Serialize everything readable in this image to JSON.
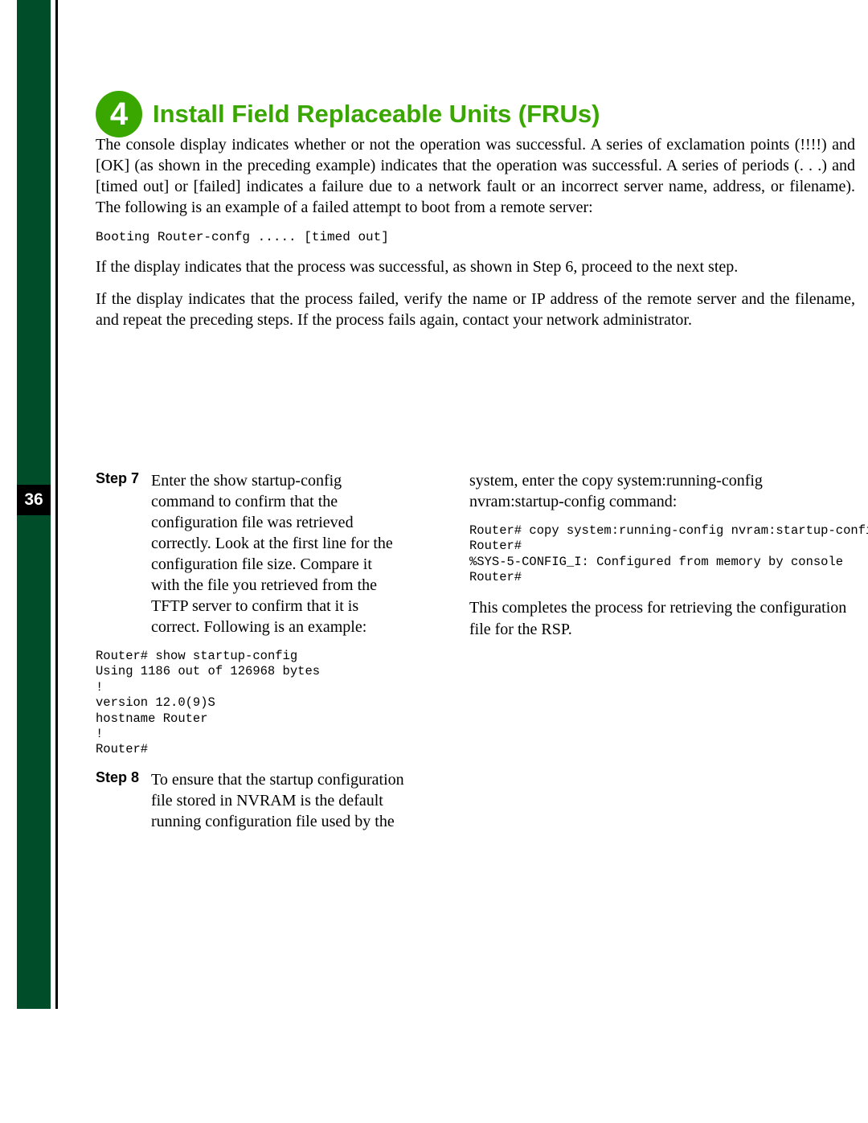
{
  "chapter": {
    "number": "4",
    "title": "Install Field Replaceable Units (FRUs)"
  },
  "page_number": "36",
  "intro": {
    "p1": "The console display indicates whether or not the operation was successful. A series of exclamation points (!!!!) and [OK] (as shown in the preceding example) indicates that the operation was successful. A series of periods (. . .) and [timed out] or [failed] indicates a failure due to a network fault or an incorrect server name, address, or filename). The following is an example of a failed attempt to boot from a remote server:",
    "code1": "Booting Router-confg ..... [timed out]",
    "p2": "If the display indicates that the process was successful, as shown in Step 6, proceed to the next step.",
    "p3": "If the display indicates that the process failed, verify the name or IP address of the remote server and the filename, and repeat the preceding steps. If the process fails again, contact your network administrator."
  },
  "step7": {
    "label": "Step 7",
    "body": "Enter the show startup-config command to confirm that the configuration file was retrieved correctly. Look at the first line for the configuration file size. Compare it with the file you retrieved from the TFTP server to confirm that it is correct. Following is an example:",
    "code_prompt": "Router# ",
    "code_cmd": "show startup-config",
    "code_rest": "\nUsing 1186 out of 126968 bytes\n!\nversion 12.0(9)S\nhostname Router\n!\nRouter#"
  },
  "step8": {
    "label": "Step 8",
    "body_left": "To ensure that the startup configuration file stored in NVRAM is the default running configuration file used by the",
    "body_right": "system, enter the copy system:running-config nvram:startup-config command:",
    "code_prompt": "Router# ",
    "code_cmd": "copy system:running-config nvram:startup-config",
    "code_rest": "\nRouter#\n%SYS-5-CONFIG_I: Configured from memory by console\nRouter#"
  },
  "completion": "This completes the process for retrieving the configuration file for the RSP."
}
